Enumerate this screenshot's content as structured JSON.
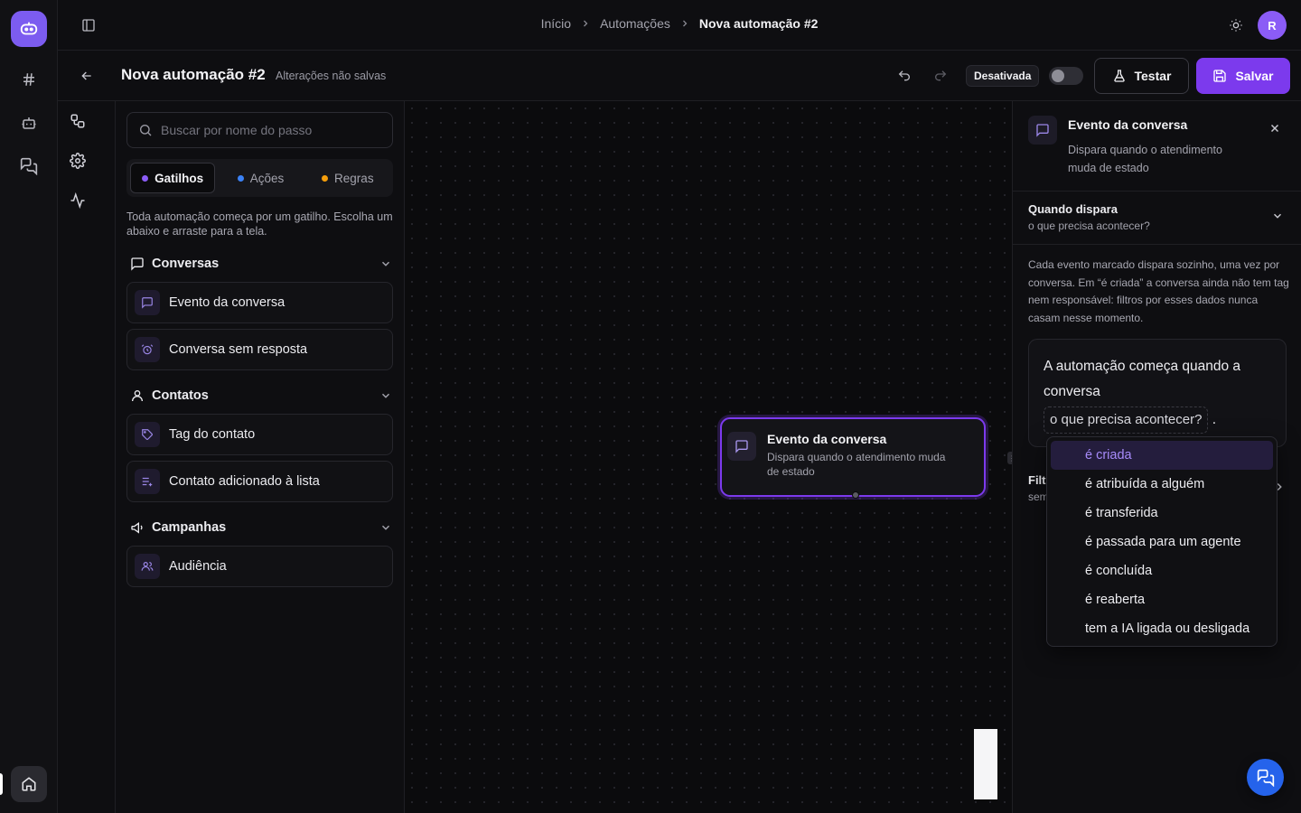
{
  "colors": {
    "accent": "#7c3aed",
    "background": "#0b0b0d",
    "panel": "#0e0e11",
    "triggers_dot": "#8b5cf6",
    "actions_dot": "#3b82f6",
    "rules_dot": "#f59e0b",
    "chat_fab": "#2563eb"
  },
  "rail": {
    "logo_icon": "bot-face-icon",
    "items": [
      {
        "name": "channels",
        "icon": "hash-icon"
      },
      {
        "name": "bots",
        "icon": "robot-icon"
      },
      {
        "name": "conversations",
        "icon": "chat-bubbles-icon"
      }
    ],
    "home_icon": "home-icon"
  },
  "topbar": {
    "breadcrumb": [
      "Início",
      "Automações",
      "Nova automação #2"
    ],
    "avatar_initial": "R"
  },
  "editor": {
    "title": "Nova automação #2",
    "unsaved_label": "Alterações não salvas",
    "status_label": "Desativada",
    "toggle_enabled": false,
    "test_label": "Testar",
    "save_label": "Salvar"
  },
  "library": {
    "search_placeholder": "Buscar por nome do passo",
    "tabs": [
      {
        "label": "Gatilhos",
        "active": true
      },
      {
        "label": "Ações",
        "active": false
      },
      {
        "label": "Regras",
        "active": false
      }
    ],
    "help": "Toda automação começa por um gatilho. Escolha um abaixo e arraste para a tela.",
    "sections": [
      {
        "title": "Conversas",
        "items": [
          "Evento da conversa",
          "Conversa sem resposta"
        ]
      },
      {
        "title": "Contatos",
        "items": [
          "Tag do contato",
          "Contato adicionado à lista"
        ]
      },
      {
        "title": "Campanhas",
        "items": [
          "Audiência"
        ]
      }
    ]
  },
  "canvas": {
    "node": {
      "title": "Evento da conversa",
      "description": "Dispara quando o atendimento muda de estado"
    }
  },
  "config": {
    "title": "Evento da conversa",
    "description": "Dispara quando o atendimento muda de estado",
    "when_title": "Quando dispara",
    "when_subtitle": "o que precisa acontecer?",
    "help": "Cada evento marcado dispara sozinho, uma vez por conversa. Em “é criada” a conversa ainda não tem tag nem responsável: filtros por esses dados nunca casam nesse momento.",
    "sentence_prefix": "A automação começa quando a conversa",
    "sentence_chip": "o que precisa acontecer?",
    "sentence_suffix": ".",
    "filters_title": "Filtr",
    "filters_subtitle": "sem",
    "dropdown_options": [
      "é criada",
      "é atribuída a alguém",
      "é transferida",
      "é passada para um agente",
      "é concluída",
      "é reaberta",
      "tem a IA ligada ou desligada"
    ],
    "dropdown_selected": "é criada"
  }
}
